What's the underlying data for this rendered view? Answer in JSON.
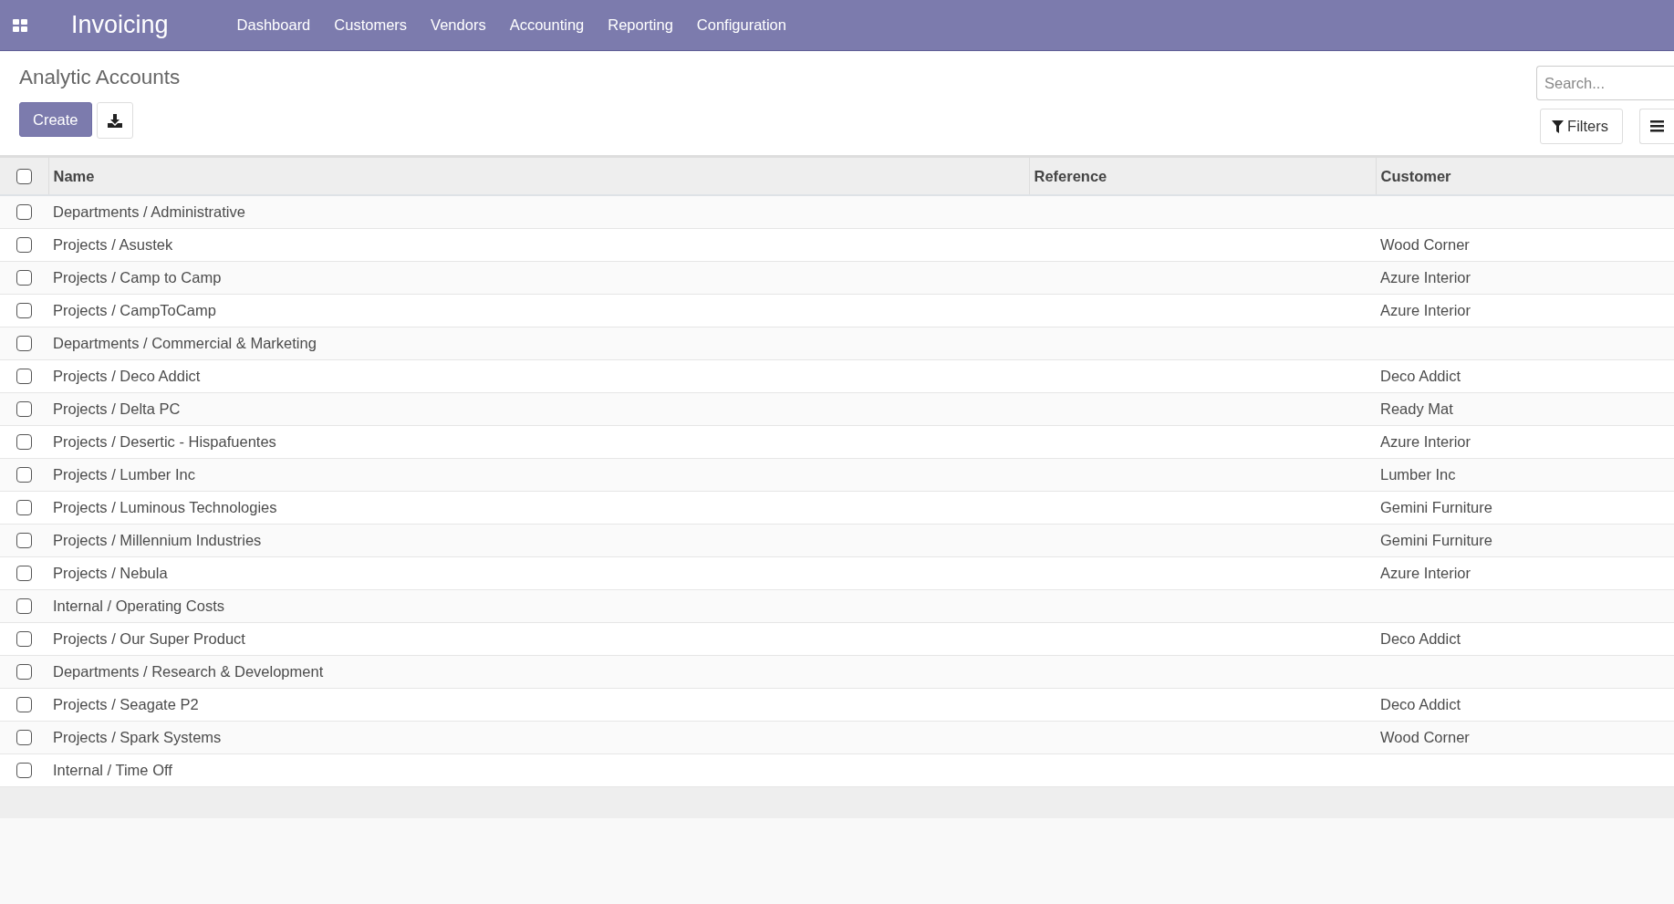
{
  "navbar": {
    "app_name": "Invoicing",
    "menu": [
      "Dashboard",
      "Customers",
      "Vendors",
      "Accounting",
      "Reporting",
      "Configuration"
    ]
  },
  "control_panel": {
    "title": "Analytic Accounts",
    "create_button": "Create",
    "search": {
      "placeholder": "Search..."
    },
    "filters_button": "Filters"
  },
  "table": {
    "select_all_checked": false,
    "columns": [
      "Name",
      "Reference",
      "Customer"
    ],
    "rows": [
      {
        "name": "Departments / Administrative",
        "reference": "",
        "customer": "",
        "checked": false
      },
      {
        "name": "Projects / Asustek",
        "reference": "",
        "customer": "Wood Corner",
        "checked": false
      },
      {
        "name": "Projects / Camp to Camp",
        "reference": "",
        "customer": "Azure Interior",
        "checked": false
      },
      {
        "name": "Projects / CampToCamp",
        "reference": "",
        "customer": "Azure Interior",
        "checked": false
      },
      {
        "name": "Departments / Commercial & Marketing",
        "reference": "",
        "customer": "",
        "checked": false
      },
      {
        "name": "Projects / Deco Addict",
        "reference": "",
        "customer": "Deco Addict",
        "checked": false
      },
      {
        "name": "Projects / Delta PC",
        "reference": "",
        "customer": "Ready Mat",
        "checked": false
      },
      {
        "name": "Projects / Desertic - Hispafuentes",
        "reference": "",
        "customer": "Azure Interior",
        "checked": false
      },
      {
        "name": "Projects / Lumber Inc",
        "reference": "",
        "customer": "Lumber Inc",
        "checked": false
      },
      {
        "name": "Projects / Luminous Technologies",
        "reference": "",
        "customer": "Gemini Furniture",
        "checked": false
      },
      {
        "name": "Projects / Millennium Industries",
        "reference": "",
        "customer": "Gemini Furniture",
        "checked": false
      },
      {
        "name": "Projects / Nebula",
        "reference": "",
        "customer": "Azure Interior",
        "checked": false
      },
      {
        "name": "Internal / Operating Costs",
        "reference": "",
        "customer": "",
        "checked": false
      },
      {
        "name": "Projects / Our Super Product",
        "reference": "",
        "customer": "Deco Addict",
        "checked": false
      },
      {
        "name": "Departments / Research & Development",
        "reference": "",
        "customer": "",
        "checked": false
      },
      {
        "name": "Projects / Seagate P2",
        "reference": "",
        "customer": "Deco Addict",
        "checked": false
      },
      {
        "name": "Projects / Spark Systems",
        "reference": "",
        "customer": "Wood Corner",
        "checked": false
      },
      {
        "name": "Internal / Time Off",
        "reference": "",
        "customer": "",
        "checked": false
      }
    ]
  }
}
